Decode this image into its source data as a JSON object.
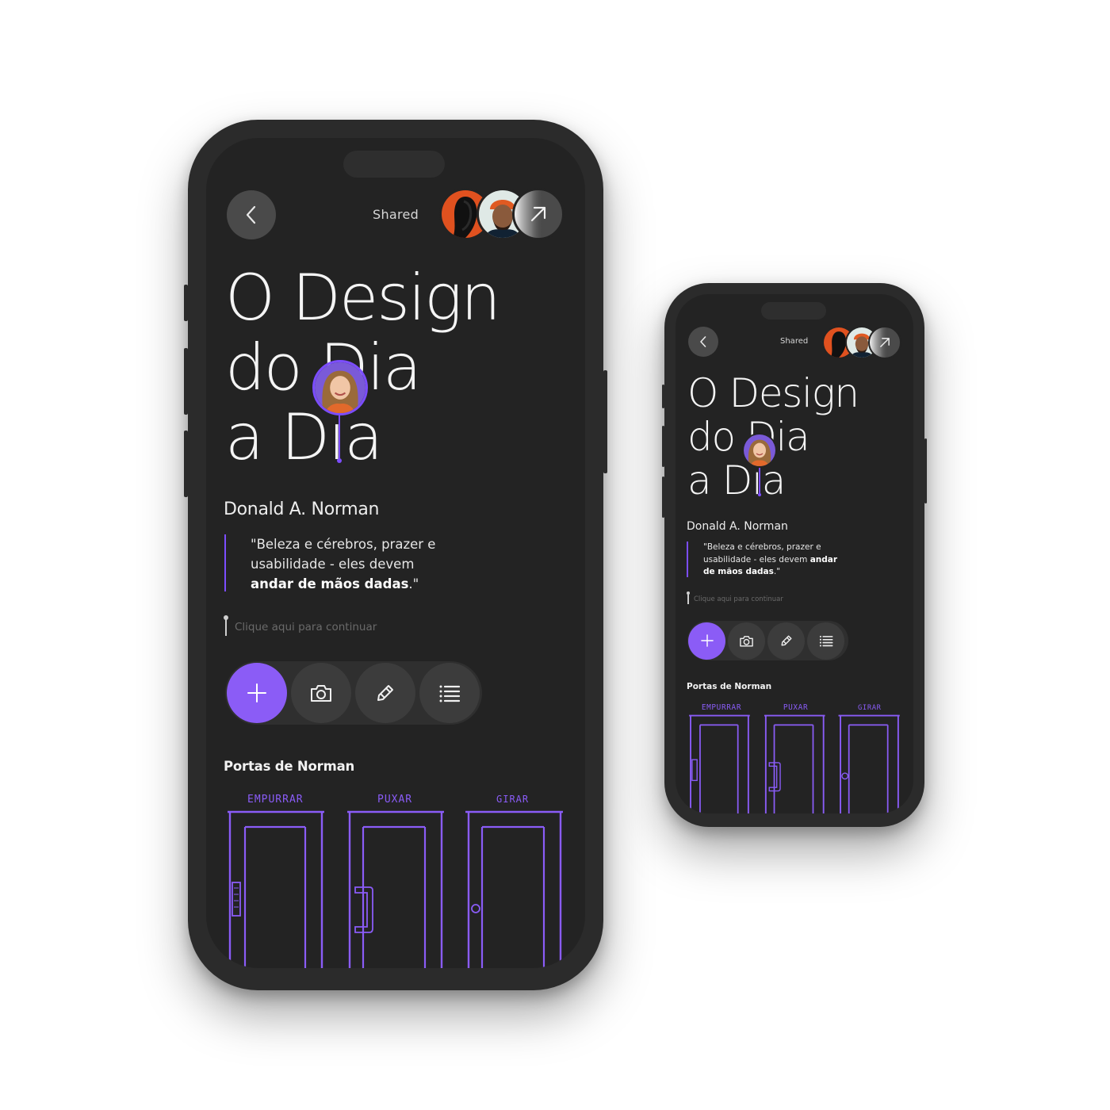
{
  "app": {
    "shared_label": "Shared",
    "title_lines": [
      "O Design",
      "do Dia",
      "a Dia"
    ],
    "author": "Donald A. Norman",
    "quote": {
      "regular": "\"Beleza e cérebros, prazer e usabilidade - eles devem ",
      "bold": "andar de mãos dadas",
      "end": ".\""
    },
    "cta": "Clique aqui para continuar",
    "toolbar": {
      "add_icon": "plus-icon",
      "camera_icon": "camera-icon",
      "pen_icon": "pen-icon",
      "list_icon": "list-icon"
    },
    "section_title": "Portas de Norman",
    "doors": [
      {
        "label": "EMPURRAR",
        "handle": "push-plate"
      },
      {
        "label": "PUXAR",
        "handle": "pull-handle"
      },
      {
        "label": "GIRAR",
        "handle": "knob"
      }
    ]
  },
  "colors": {
    "accent": "#8b5cf6",
    "background": "#232323",
    "frame": "#2b2b2b"
  }
}
